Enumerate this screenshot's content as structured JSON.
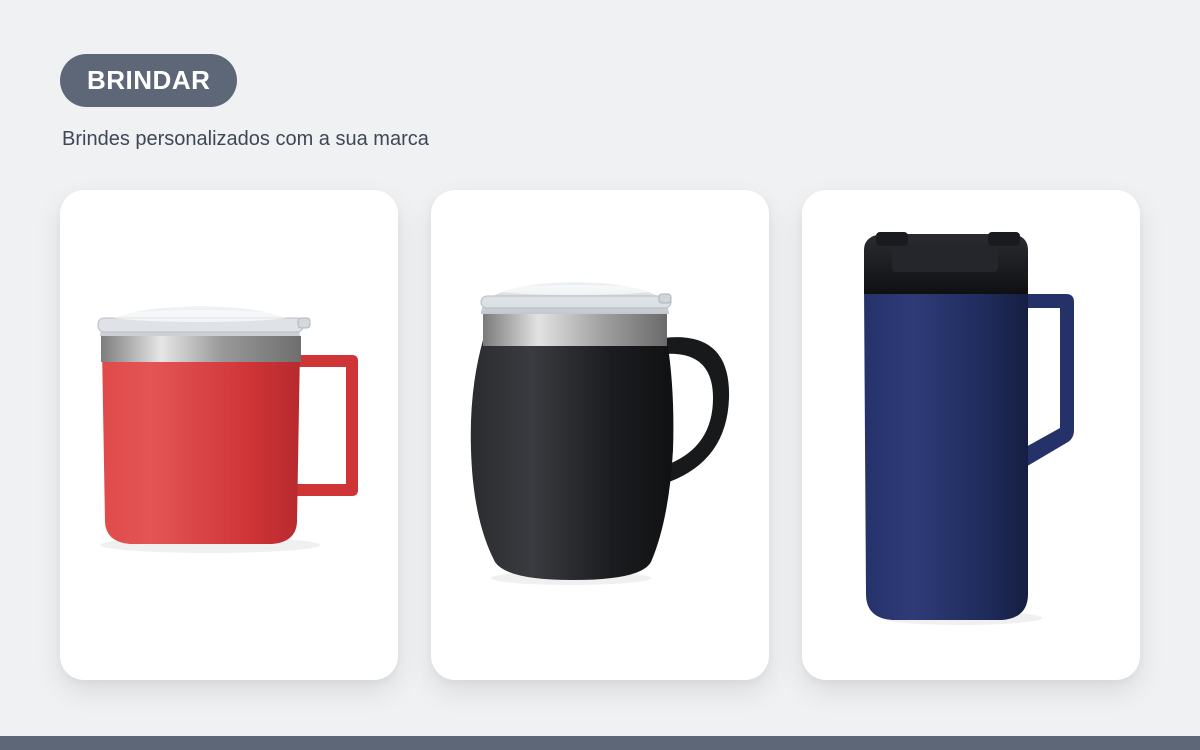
{
  "header": {
    "brand_label": "BRINDAR",
    "tagline": "Brindes personalizados com a sua marca"
  },
  "products": [
    {
      "icon": "red-camping-mug-icon",
      "color": "#d63a3d"
    },
    {
      "icon": "black-wine-mug-icon",
      "color": "#1e1f22"
    },
    {
      "icon": "navy-travel-mug-icon",
      "color": "#1f2b58"
    }
  ],
  "colors": {
    "background": "#f0f1f3",
    "brand": "#5e6777",
    "card": "#ffffff",
    "text": "#3f4656"
  }
}
